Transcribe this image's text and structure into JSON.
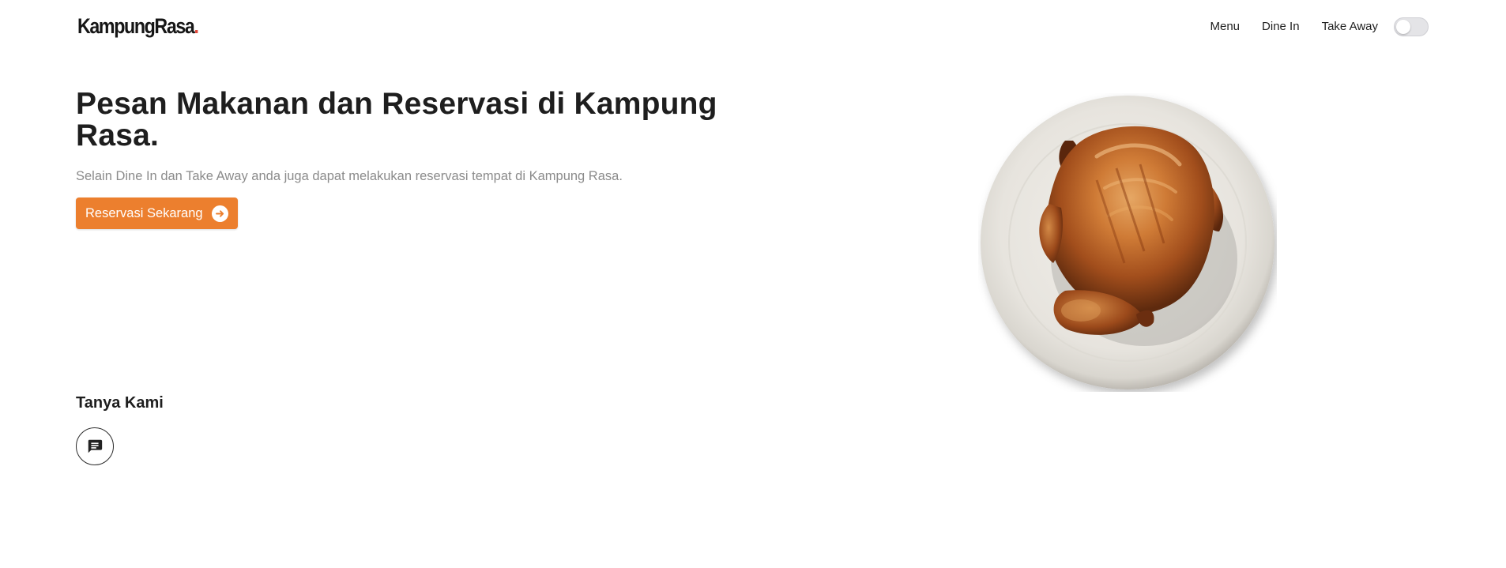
{
  "brand": {
    "name": "KampungRasa",
    "dot": "."
  },
  "nav": {
    "items": [
      {
        "label": "Menu"
      },
      {
        "label": "Dine In"
      },
      {
        "label": "Take Away"
      }
    ],
    "toggle_state": "off"
  },
  "hero": {
    "title": "Pesan Makanan dan Reservasi di Kampung Rasa.",
    "subtitle": "Selain Dine In dan Take Away anda juga dapat melakukan reservasi tempat di Kampung Rasa.",
    "cta_label": "Reservasi Sekarang",
    "cta_icon": "arrow-right-circle-icon",
    "image": "roast-chicken-on-plate"
  },
  "contact": {
    "title": "Tanya Kami",
    "icon": "chat-message-icon"
  },
  "colors": {
    "accent": "#ec7f2e",
    "brand_dot": "#e0473a",
    "text": "#1e1e1e",
    "muted": "#8b8b8b"
  }
}
